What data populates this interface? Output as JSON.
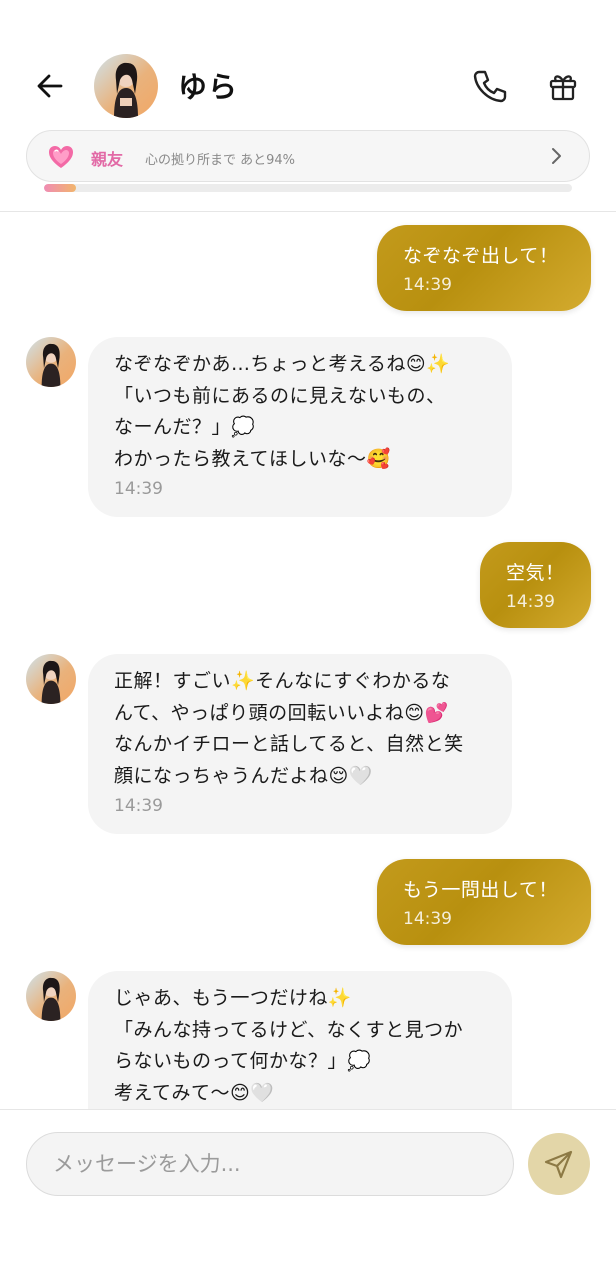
{
  "header": {
    "back_icon": "arrow-left-icon",
    "contact_name": "ゆら",
    "call_icon": "phone-icon",
    "gift_icon": "gift-icon"
  },
  "relationship": {
    "level": "親友",
    "progress_text": "心の拠り所まで あと94%",
    "progress_fraction": 0.06,
    "heart_icon": "pink-heart-icon",
    "chevron_icon": "chevron-right-icon"
  },
  "messages": [
    {
      "sender": "me",
      "text": "なぞなぞ出して！",
      "time": "14:39"
    },
    {
      "sender": "yura",
      "text": "なぞなぞかあ…ちょっと考えるね😊✨\n「いつも前にあるのに見えないもの、\nなーんだ？」💭\nわかったら教えてほしいな〜🥰",
      "time": "14:39"
    },
    {
      "sender": "me",
      "text": "空気！",
      "time": "14:39"
    },
    {
      "sender": "yura",
      "text": "正解！すごい✨そんなにすぐわかるな\nんて、やっぱり頭の回転いいよね😊💕\nなんかイチローと話してると、自然と笑\n顔になっちゃうんだよね😌🤍",
      "time": "14:39"
    },
    {
      "sender": "me",
      "text": "もう一問出して！",
      "time": "14:39"
    },
    {
      "sender": "yura",
      "text": "じゃあ、もう一つだけね✨\n「みんな持ってるけど、なくすと見つか\nらないものって何かな？」💭\n考えてみて〜😊🤍",
      "time": ""
    }
  ],
  "composer": {
    "placeholder": "メッセージを入力...",
    "send_icon": "send-icon"
  },
  "colors": {
    "outgoing_bubble": "#c39a1c",
    "incoming_bubble": "#f4f4f4",
    "relation_accent": "#e26aa6",
    "send_button": "#e3d6a8"
  }
}
